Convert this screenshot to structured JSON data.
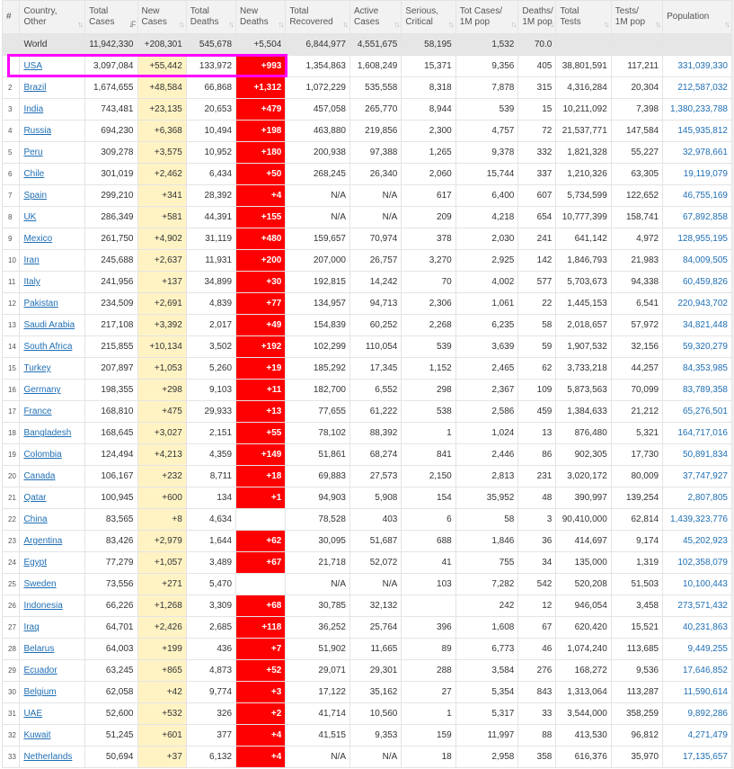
{
  "headers": {
    "idx": "#",
    "country": [
      "Country,",
      "Other"
    ],
    "total_cases": [
      "Total",
      "Cases"
    ],
    "new_cases": [
      "New",
      "Cases"
    ],
    "total_deaths": [
      "Total",
      "Deaths"
    ],
    "new_deaths": [
      "New",
      "Deaths"
    ],
    "total_recovered": [
      "Total",
      "Recovered"
    ],
    "active_cases": [
      "Active",
      "Cases"
    ],
    "serious": [
      "Serious,",
      "Critical"
    ],
    "cases_per_m": [
      "Tot Cases/",
      "1M pop"
    ],
    "deaths_per_m": [
      "Deaths/",
      "1M pop"
    ],
    "total_tests": [
      "Total",
      "Tests"
    ],
    "tests_per_m": [
      "Tests/",
      "1M pop"
    ],
    "population": [
      "Population",
      ""
    ]
  },
  "sort_icon": "sort-arrows-icon",
  "colors": {
    "new_cases_bg": "#fff3c4",
    "new_deaths_bg": "#ff0000",
    "link": "#1f6fb5",
    "highlight_border": "#ff00ff"
  },
  "world_row": {
    "idx": "",
    "country": "World",
    "total_cases": "11,942,330",
    "new_cases": "+208,301",
    "total_deaths": "545,678",
    "new_deaths": "+5,504",
    "total_recovered": "6,844,977",
    "active_cases": "4,551,675",
    "serious": "58,195",
    "cases_per_m": "1,532",
    "deaths_per_m": "70.0",
    "total_tests": "",
    "tests_per_m": "",
    "population": ""
  },
  "rows": [
    {
      "idx": "",
      "country": "USA",
      "total_cases": "3,097,084",
      "new_cases": "+55,442",
      "total_deaths": "133,972",
      "new_deaths": "+993",
      "total_recovered": "1,354,863",
      "active_cases": "1,608,249",
      "serious": "15,371",
      "cases_per_m": "9,356",
      "deaths_per_m": "405",
      "total_tests": "38,801,591",
      "tests_per_m": "117,211",
      "population": "331,039,330"
    },
    {
      "idx": "2",
      "country": "Brazil",
      "total_cases": "1,674,655",
      "new_cases": "+48,584",
      "total_deaths": "66,868",
      "new_deaths": "+1,312",
      "total_recovered": "1,072,229",
      "active_cases": "535,558",
      "serious": "8,318",
      "cases_per_m": "7,878",
      "deaths_per_m": "315",
      "total_tests": "4,316,284",
      "tests_per_m": "20,304",
      "population": "212,587,032"
    },
    {
      "idx": "3",
      "country": "India",
      "total_cases": "743,481",
      "new_cases": "+23,135",
      "total_deaths": "20,653",
      "new_deaths": "+479",
      "total_recovered": "457,058",
      "active_cases": "265,770",
      "serious": "8,944",
      "cases_per_m": "539",
      "deaths_per_m": "15",
      "total_tests": "10,211,092",
      "tests_per_m": "7,398",
      "population": "1,380,233,788"
    },
    {
      "idx": "4",
      "country": "Russia",
      "total_cases": "694,230",
      "new_cases": "+6,368",
      "total_deaths": "10,494",
      "new_deaths": "+198",
      "total_recovered": "463,880",
      "active_cases": "219,856",
      "serious": "2,300",
      "cases_per_m": "4,757",
      "deaths_per_m": "72",
      "total_tests": "21,537,771",
      "tests_per_m": "147,584",
      "population": "145,935,812"
    },
    {
      "idx": "5",
      "country": "Peru",
      "total_cases": "309,278",
      "new_cases": "+3,575",
      "total_deaths": "10,952",
      "new_deaths": "+180",
      "total_recovered": "200,938",
      "active_cases": "97,388",
      "serious": "1,265",
      "cases_per_m": "9,378",
      "deaths_per_m": "332",
      "total_tests": "1,821,328",
      "tests_per_m": "55,227",
      "population": "32,978,661"
    },
    {
      "idx": "6",
      "country": "Chile",
      "total_cases": "301,019",
      "new_cases": "+2,462",
      "total_deaths": "6,434",
      "new_deaths": "+50",
      "total_recovered": "268,245",
      "active_cases": "26,340",
      "serious": "2,060",
      "cases_per_m": "15,744",
      "deaths_per_m": "337",
      "total_tests": "1,210,326",
      "tests_per_m": "63,305",
      "population": "19,119,079"
    },
    {
      "idx": "7",
      "country": "Spain",
      "total_cases": "299,210",
      "new_cases": "+341",
      "total_deaths": "28,392",
      "new_deaths": "+4",
      "total_recovered": "N/A",
      "active_cases": "N/A",
      "serious": "617",
      "cases_per_m": "6,400",
      "deaths_per_m": "607",
      "total_tests": "5,734,599",
      "tests_per_m": "122,652",
      "population": "46,755,169"
    },
    {
      "idx": "8",
      "country": "UK",
      "total_cases": "286,349",
      "new_cases": "+581",
      "total_deaths": "44,391",
      "new_deaths": "+155",
      "total_recovered": "N/A",
      "active_cases": "N/A",
      "serious": "209",
      "cases_per_m": "4,218",
      "deaths_per_m": "654",
      "total_tests": "10,777,399",
      "tests_per_m": "158,741",
      "population": "67,892,858"
    },
    {
      "idx": "9",
      "country": "Mexico",
      "total_cases": "261,750",
      "new_cases": "+4,902",
      "total_deaths": "31,119",
      "new_deaths": "+480",
      "total_recovered": "159,657",
      "active_cases": "70,974",
      "serious": "378",
      "cases_per_m": "2,030",
      "deaths_per_m": "241",
      "total_tests": "641,142",
      "tests_per_m": "4,972",
      "population": "128,955,195"
    },
    {
      "idx": "10",
      "country": "Iran",
      "total_cases": "245,688",
      "new_cases": "+2,637",
      "total_deaths": "11,931",
      "new_deaths": "+200",
      "total_recovered": "207,000",
      "active_cases": "26,757",
      "serious": "3,270",
      "cases_per_m": "2,925",
      "deaths_per_m": "142",
      "total_tests": "1,846,793",
      "tests_per_m": "21,983",
      "population": "84,009,505"
    },
    {
      "idx": "11",
      "country": "Italy",
      "total_cases": "241,956",
      "new_cases": "+137",
      "total_deaths": "34,899",
      "new_deaths": "+30",
      "total_recovered": "192,815",
      "active_cases": "14,242",
      "serious": "70",
      "cases_per_m": "4,002",
      "deaths_per_m": "577",
      "total_tests": "5,703,673",
      "tests_per_m": "94,338",
      "population": "60,459,826"
    },
    {
      "idx": "12",
      "country": "Pakistan",
      "total_cases": "234,509",
      "new_cases": "+2,691",
      "total_deaths": "4,839",
      "new_deaths": "+77",
      "total_recovered": "134,957",
      "active_cases": "94,713",
      "serious": "2,306",
      "cases_per_m": "1,061",
      "deaths_per_m": "22",
      "total_tests": "1,445,153",
      "tests_per_m": "6,541",
      "population": "220,943,702"
    },
    {
      "idx": "13",
      "country": "Saudi Arabia",
      "total_cases": "217,108",
      "new_cases": "+3,392",
      "total_deaths": "2,017",
      "new_deaths": "+49",
      "total_recovered": "154,839",
      "active_cases": "60,252",
      "serious": "2,268",
      "cases_per_m": "6,235",
      "deaths_per_m": "58",
      "total_tests": "2,018,657",
      "tests_per_m": "57,972",
      "population": "34,821,448"
    },
    {
      "idx": "14",
      "country": "South Africa",
      "total_cases": "215,855",
      "new_cases": "+10,134",
      "total_deaths": "3,502",
      "new_deaths": "+192",
      "total_recovered": "102,299",
      "active_cases": "110,054",
      "serious": "539",
      "cases_per_m": "3,639",
      "deaths_per_m": "59",
      "total_tests": "1,907,532",
      "tests_per_m": "32,156",
      "population": "59,320,279"
    },
    {
      "idx": "15",
      "country": "Turkey",
      "total_cases": "207,897",
      "new_cases": "+1,053",
      "total_deaths": "5,260",
      "new_deaths": "+19",
      "total_recovered": "185,292",
      "active_cases": "17,345",
      "serious": "1,152",
      "cases_per_m": "2,465",
      "deaths_per_m": "62",
      "total_tests": "3,733,218",
      "tests_per_m": "44,257",
      "population": "84,353,985"
    },
    {
      "idx": "16",
      "country": "Germany",
      "total_cases": "198,355",
      "new_cases": "+298",
      "total_deaths": "9,103",
      "new_deaths": "+11",
      "total_recovered": "182,700",
      "active_cases": "6,552",
      "serious": "298",
      "cases_per_m": "2,367",
      "deaths_per_m": "109",
      "total_tests": "5,873,563",
      "tests_per_m": "70,099",
      "population": "83,789,358"
    },
    {
      "idx": "17",
      "country": "France",
      "total_cases": "168,810",
      "new_cases": "+475",
      "total_deaths": "29,933",
      "new_deaths": "+13",
      "total_recovered": "77,655",
      "active_cases": "61,222",
      "serious": "538",
      "cases_per_m": "2,586",
      "deaths_per_m": "459",
      "total_tests": "1,384,633",
      "tests_per_m": "21,212",
      "population": "65,276,501"
    },
    {
      "idx": "18",
      "country": "Bangladesh",
      "total_cases": "168,645",
      "new_cases": "+3,027",
      "total_deaths": "2,151",
      "new_deaths": "+55",
      "total_recovered": "78,102",
      "active_cases": "88,392",
      "serious": "1",
      "cases_per_m": "1,024",
      "deaths_per_m": "13",
      "total_tests": "876,480",
      "tests_per_m": "5,321",
      "population": "164,717,016"
    },
    {
      "idx": "19",
      "country": "Colombia",
      "total_cases": "124,494",
      "new_cases": "+4,213",
      "total_deaths": "4,359",
      "new_deaths": "+149",
      "total_recovered": "51,861",
      "active_cases": "68,274",
      "serious": "841",
      "cases_per_m": "2,446",
      "deaths_per_m": "86",
      "total_tests": "902,305",
      "tests_per_m": "17,730",
      "population": "50,891,834"
    },
    {
      "idx": "20",
      "country": "Canada",
      "total_cases": "106,167",
      "new_cases": "+232",
      "total_deaths": "8,711",
      "new_deaths": "+18",
      "total_recovered": "69,883",
      "active_cases": "27,573",
      "serious": "2,150",
      "cases_per_m": "2,813",
      "deaths_per_m": "231",
      "total_tests": "3,020,172",
      "tests_per_m": "80,009",
      "population": "37,747,927"
    },
    {
      "idx": "21",
      "country": "Qatar",
      "total_cases": "100,945",
      "new_cases": "+600",
      "total_deaths": "134",
      "new_deaths": "+1",
      "total_recovered": "94,903",
      "active_cases": "5,908",
      "serious": "154",
      "cases_per_m": "35,952",
      "deaths_per_m": "48",
      "total_tests": "390,997",
      "tests_per_m": "139,254",
      "population": "2,807,805"
    },
    {
      "idx": "22",
      "country": "China",
      "total_cases": "83,565",
      "new_cases": "+8",
      "total_deaths": "4,634",
      "new_deaths": "",
      "total_recovered": "78,528",
      "active_cases": "403",
      "serious": "6",
      "cases_per_m": "58",
      "deaths_per_m": "3",
      "total_tests": "90,410,000",
      "tests_per_m": "62,814",
      "population": "1,439,323,776"
    },
    {
      "idx": "23",
      "country": "Argentina",
      "total_cases": "83,426",
      "new_cases": "+2,979",
      "total_deaths": "1,644",
      "new_deaths": "+62",
      "total_recovered": "30,095",
      "active_cases": "51,687",
      "serious": "688",
      "cases_per_m": "1,846",
      "deaths_per_m": "36",
      "total_tests": "414,697",
      "tests_per_m": "9,174",
      "population": "45,202,923"
    },
    {
      "idx": "24",
      "country": "Egypt",
      "total_cases": "77,279",
      "new_cases": "+1,057",
      "total_deaths": "3,489",
      "new_deaths": "+67",
      "total_recovered": "21,718",
      "active_cases": "52,072",
      "serious": "41",
      "cases_per_m": "755",
      "deaths_per_m": "34",
      "total_tests": "135,000",
      "tests_per_m": "1,319",
      "population": "102,358,079"
    },
    {
      "idx": "25",
      "country": "Sweden",
      "total_cases": "73,556",
      "new_cases": "+271",
      "total_deaths": "5,470",
      "new_deaths": "",
      "total_recovered": "N/A",
      "active_cases": "N/A",
      "serious": "103",
      "cases_per_m": "7,282",
      "deaths_per_m": "542",
      "total_tests": "520,208",
      "tests_per_m": "51,503",
      "population": "10,100,443"
    },
    {
      "idx": "26",
      "country": "Indonesia",
      "total_cases": "66,226",
      "new_cases": "+1,268",
      "total_deaths": "3,309",
      "new_deaths": "+68",
      "total_recovered": "30,785",
      "active_cases": "32,132",
      "serious": "",
      "cases_per_m": "242",
      "deaths_per_m": "12",
      "total_tests": "946,054",
      "tests_per_m": "3,458",
      "population": "273,571,432"
    },
    {
      "idx": "27",
      "country": "Iraq",
      "total_cases": "64,701",
      "new_cases": "+2,426",
      "total_deaths": "2,685",
      "new_deaths": "+118",
      "total_recovered": "36,252",
      "active_cases": "25,764",
      "serious": "396",
      "cases_per_m": "1,608",
      "deaths_per_m": "67",
      "total_tests": "620,420",
      "tests_per_m": "15,521",
      "population": "40,231,863"
    },
    {
      "idx": "28",
      "country": "Belarus",
      "total_cases": "64,003",
      "new_cases": "+199",
      "total_deaths": "436",
      "new_deaths": "+7",
      "total_recovered": "51,902",
      "active_cases": "11,665",
      "serious": "89",
      "cases_per_m": "6,773",
      "deaths_per_m": "46",
      "total_tests": "1,074,240",
      "tests_per_m": "113,685",
      "population": "9,449,255"
    },
    {
      "idx": "29",
      "country": "Ecuador",
      "total_cases": "63,245",
      "new_cases": "+865",
      "total_deaths": "4,873",
      "new_deaths": "+52",
      "total_recovered": "29,071",
      "active_cases": "29,301",
      "serious": "288",
      "cases_per_m": "3,584",
      "deaths_per_m": "276",
      "total_tests": "168,272",
      "tests_per_m": "9,536",
      "population": "17,646,852"
    },
    {
      "idx": "30",
      "country": "Belgium",
      "total_cases": "62,058",
      "new_cases": "+42",
      "total_deaths": "9,774",
      "new_deaths": "+3",
      "total_recovered": "17,122",
      "active_cases": "35,162",
      "serious": "27",
      "cases_per_m": "5,354",
      "deaths_per_m": "843",
      "total_tests": "1,313,064",
      "tests_per_m": "113,287",
      "population": "11,590,614"
    },
    {
      "idx": "31",
      "country": "UAE",
      "total_cases": "52,600",
      "new_cases": "+532",
      "total_deaths": "326",
      "new_deaths": "+2",
      "total_recovered": "41,714",
      "active_cases": "10,560",
      "serious": "1",
      "cases_per_m": "5,317",
      "deaths_per_m": "33",
      "total_tests": "3,544,000",
      "tests_per_m": "358,259",
      "population": "9,892,286"
    },
    {
      "idx": "32",
      "country": "Kuwait",
      "total_cases": "51,245",
      "new_cases": "+601",
      "total_deaths": "377",
      "new_deaths": "+4",
      "total_recovered": "41,515",
      "active_cases": "9,353",
      "serious": "159",
      "cases_per_m": "11,997",
      "deaths_per_m": "88",
      "total_tests": "413,530",
      "tests_per_m": "96,812",
      "population": "4,271,479"
    },
    {
      "idx": "33",
      "country": "Netherlands",
      "total_cases": "50,694",
      "new_cases": "+37",
      "total_deaths": "6,132",
      "new_deaths": "+4",
      "total_recovered": "N/A",
      "active_cases": "N/A",
      "serious": "18",
      "cases_per_m": "2,958",
      "deaths_per_m": "358",
      "total_tests": "616,376",
      "tests_per_m": "35,970",
      "population": "17,135,657"
    }
  ]
}
